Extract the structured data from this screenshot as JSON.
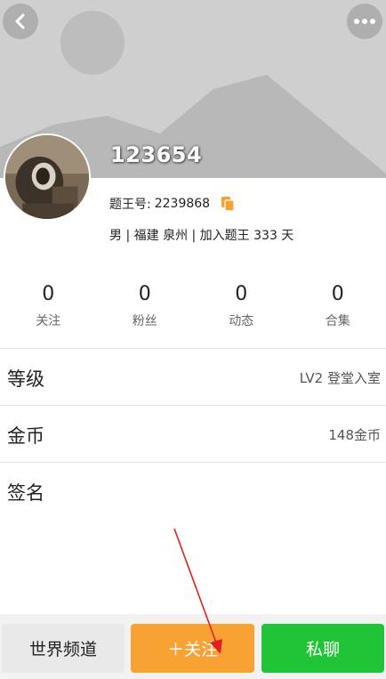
{
  "header": {
    "back_icon": "chevron-left-icon",
    "more_icon": "more-dots-icon"
  },
  "profile": {
    "username": "123654",
    "id_label": "题王号:",
    "id_value": "2239868",
    "info": "男 | 福建 泉州 | 加入题王 333 天",
    "colors": {
      "copy_icon": "#f7a233"
    }
  },
  "stats": [
    {
      "value": "0",
      "label": "关注"
    },
    {
      "value": "0",
      "label": "粉丝"
    },
    {
      "value": "0",
      "label": "动态"
    },
    {
      "value": "0",
      "label": "合集"
    }
  ],
  "details": {
    "level_label": "等级",
    "level_value": "LV2 登堂入室",
    "coins_label": "金币",
    "coins_value": "148金币",
    "signature_label": "签名"
  },
  "actions": {
    "world_channel": "世界频道",
    "follow": "＋关注",
    "private_chat": "私聊",
    "colors": {
      "follow": "#f7a233",
      "chat": "#21c437",
      "annotation_arrow": "#e02020"
    }
  }
}
